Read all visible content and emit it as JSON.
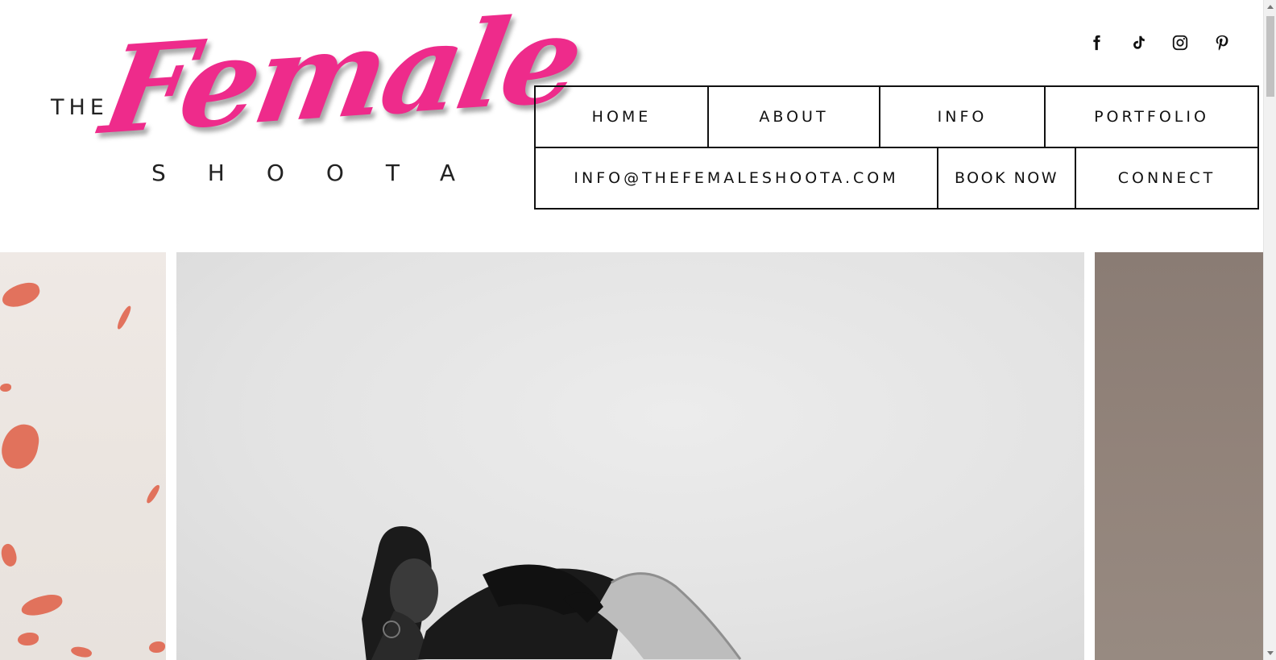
{
  "logo": {
    "the": "THE",
    "female": "Female",
    "shoota": "SHOOTA",
    "accent_color": "#ee2b8b"
  },
  "social": [
    {
      "name": "facebook-icon"
    },
    {
      "name": "tiktok-icon"
    },
    {
      "name": "instagram-icon"
    },
    {
      "name": "pinterest-icon"
    }
  ],
  "nav": {
    "row1": {
      "home": "HOME",
      "about": "ABOUT",
      "info": "INFO",
      "portfolio": "PORTFOLIO"
    },
    "row2": {
      "email": "INFO@THEFEMALESHOOTA.COM",
      "book": "BOOK NOW",
      "connect": "CONNECT"
    }
  },
  "gallery": {
    "images": [
      {
        "name": "rose-petals-photo"
      },
      {
        "name": "bw-portrait-photo"
      },
      {
        "name": "taupe-photo"
      }
    ]
  }
}
